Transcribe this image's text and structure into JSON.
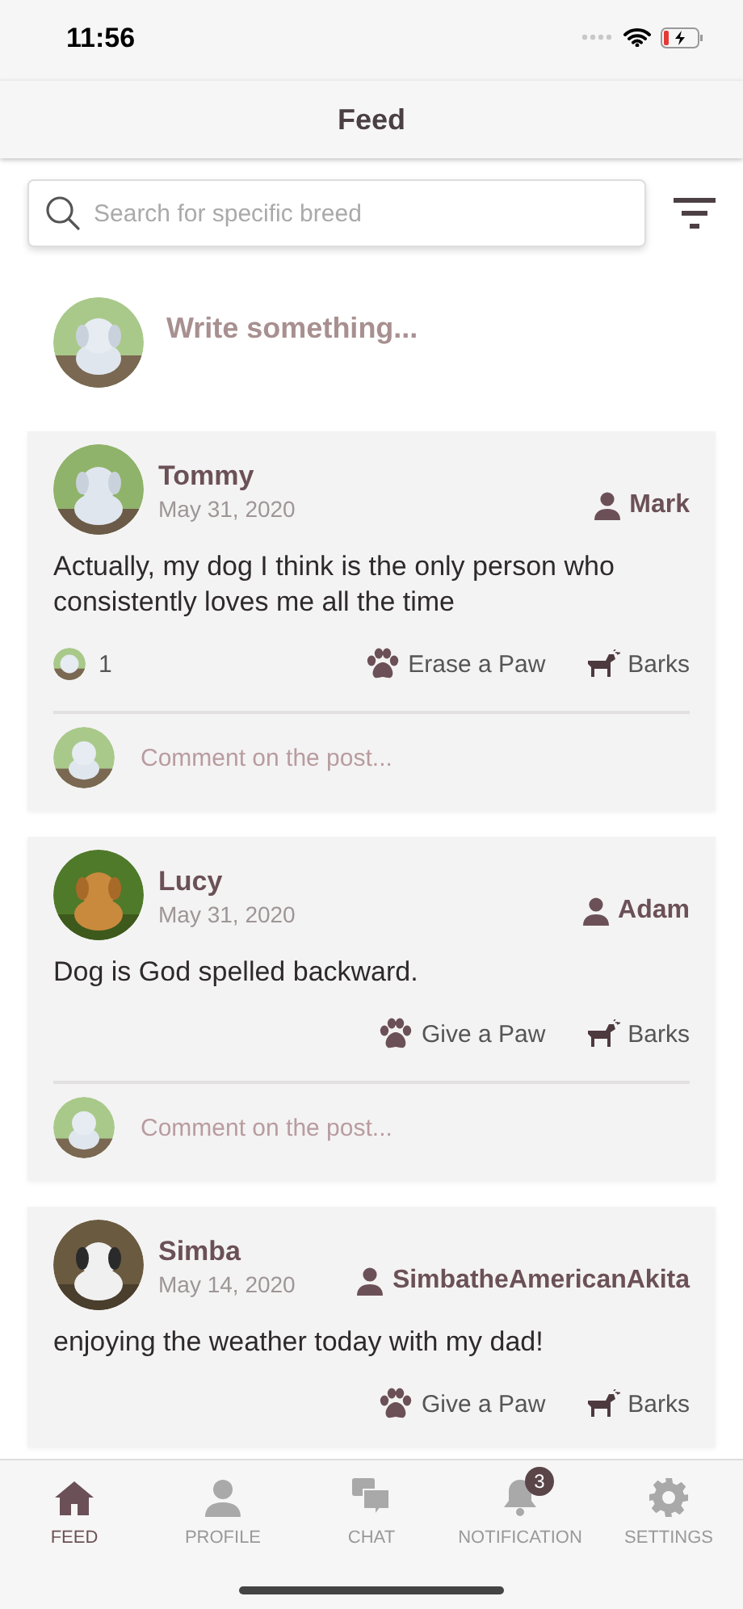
{
  "status_bar": {
    "time": "11:56"
  },
  "header": {
    "title": "Feed"
  },
  "search": {
    "placeholder": "Search for specific breed"
  },
  "composer": {
    "placeholder": "Write something..."
  },
  "posts": [
    {
      "name": "Tommy",
      "date": "May 31, 2020",
      "owner": "Mark",
      "text": "Actually, my dog I think is the only person who consistently loves me all the time",
      "likes": "1",
      "paw_action": "Erase a Paw",
      "barks": "Barks",
      "comment_placeholder": "Comment on the post..."
    },
    {
      "name": "Lucy",
      "date": "May 31, 2020",
      "owner": "Adam",
      "text": "Dog is God spelled backward.",
      "paw_action": "Give a Paw",
      "barks": "Barks",
      "comment_placeholder": "Comment on the post..."
    },
    {
      "name": "Simba",
      "date": "May 14, 2020",
      "owner": "SimbatheAmericanAkita",
      "text": "enjoying the weather today with my dad!",
      "paw_action": "Give a Paw",
      "barks": "Barks"
    }
  ],
  "tabs": [
    {
      "kind": "home",
      "label": "FEED",
      "selected": true
    },
    {
      "kind": "profile",
      "label": "PROFILE",
      "selected": false
    },
    {
      "kind": "chat",
      "label": "CHAT",
      "selected": false
    },
    {
      "kind": "bell",
      "label": "NOTIFICATION",
      "selected": false,
      "badge": "3"
    },
    {
      "kind": "gear",
      "label": "SETTINGS",
      "selected": false
    }
  ]
}
